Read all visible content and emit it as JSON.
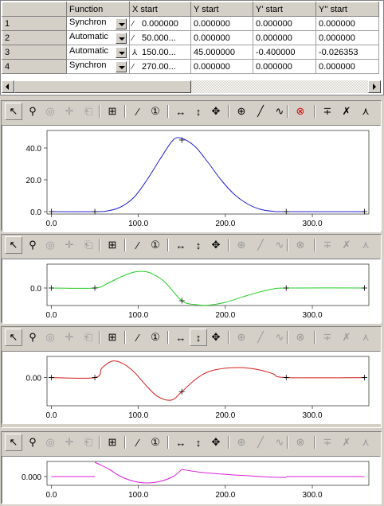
{
  "table": {
    "columns": [
      "",
      "Function",
      "X start",
      "Y start",
      "Y' start",
      "Y'' start"
    ],
    "rows": [
      {
        "num": "1",
        "function": "Synchron",
        "x_start": "0.000000",
        "y_start": "0.000000",
        "yp_start": "0.000000",
        "ypp_start": "0.000000"
      },
      {
        "num": "2",
        "function": "Automatic",
        "x_start": "50.000...",
        "y_start": "0.000000",
        "yp_start": "0.000000",
        "ypp_start": "0.000000"
      },
      {
        "num": "3",
        "function": "Automatic",
        "x_start": "150.00...",
        "y_start": "45.000000",
        "yp_start": "-0.400000",
        "ypp_start": "-0.026353"
      },
      {
        "num": "4",
        "function": "Synchron",
        "x_start": "270.00...",
        "y_start": "0.000000",
        "yp_start": "0.000000",
        "ypp_start": "0.000000"
      }
    ]
  },
  "toolbar_icons": [
    "pointer-icon",
    "zoom-icon",
    "zoom-out-icon",
    "pan-icon",
    "copy-icon",
    "grid-icon",
    "tangent-icon",
    "point-number-icon",
    "zoom-x-icon",
    "zoom-y-icon",
    "zoom-xy-icon",
    "add-point-icon",
    "line-icon",
    "curve-icon",
    "delete-icon",
    "split-icon",
    "cut-icon",
    "fork-icon"
  ],
  "plots": [
    {
      "name": "position",
      "color": "#1f1fcf",
      "ytick_labels": [
        "0.0",
        "20.0",
        "40.0"
      ],
      "yticks": [
        0,
        20,
        40
      ],
      "ylim": [
        -1.5,
        51
      ],
      "xtick_labels": [
        "0.0",
        "100.0",
        "200.0",
        "300.0"
      ],
      "xticks": [
        0,
        100,
        200,
        300
      ],
      "xlim": [
        -5,
        365
      ],
      "points": [
        [
          0,
          0
        ],
        [
          50,
          0
        ],
        [
          65,
          0.5
        ],
        [
          80,
          3
        ],
        [
          95,
          9
        ],
        [
          110,
          20
        ],
        [
          125,
          33
        ],
        [
          140,
          45
        ],
        [
          150,
          46
        ],
        [
          165,
          41
        ],
        [
          180,
          31
        ],
        [
          195,
          20
        ],
        [
          210,
          11
        ],
        [
          225,
          5
        ],
        [
          240,
          1.5
        ],
        [
          255,
          0.2
        ],
        [
          270,
          0
        ],
        [
          360,
          0
        ]
      ],
      "markers": [
        [
          0,
          0
        ],
        [
          50,
          0
        ],
        [
          150,
          45
        ],
        [
          270,
          0
        ],
        [
          360,
          0
        ]
      ]
    },
    {
      "name": "velocity",
      "color": "#22cc22",
      "ytick_labels": [
        "0.0"
      ],
      "yticks": [
        0
      ],
      "ylim": [
        -0.55,
        0.75
      ],
      "xtick_labels": [
        "0.0",
        "100.0",
        "200.0",
        "300.0"
      ],
      "xticks": [
        0,
        100,
        200,
        300
      ],
      "xlim": [
        -5,
        365
      ],
      "points": [
        [
          0,
          0
        ],
        [
          50,
          0
        ],
        [
          65,
          0.15
        ],
        [
          80,
          0.35
        ],
        [
          95,
          0.5
        ],
        [
          105,
          0.52
        ],
        [
          115,
          0.46
        ],
        [
          130,
          0.2
        ],
        [
          150,
          -0.4
        ],
        [
          165,
          -0.52
        ],
        [
          180,
          -0.54
        ],
        [
          200,
          -0.45
        ],
        [
          220,
          -0.28
        ],
        [
          240,
          -0.12
        ],
        [
          255,
          -0.03
        ],
        [
          270,
          0
        ],
        [
          360,
          0
        ]
      ],
      "markers": [
        [
          0,
          0
        ],
        [
          50,
          0
        ],
        [
          150,
          -0.4
        ],
        [
          270,
          0
        ],
        [
          360,
          0
        ]
      ]
    },
    {
      "name": "acceleration",
      "color": "#d41c1c",
      "ytick_labels": [
        "0.00"
      ],
      "yticks": [
        0
      ],
      "ylim": [
        -0.06,
        0.045
      ],
      "xtick_labels": [
        "0.0",
        "100.0",
        "200.0",
        "300.0"
      ],
      "xticks": [
        0,
        100,
        200,
        300
      ],
      "xlim": [
        -5,
        365
      ],
      "points": [
        [
          0,
          0
        ],
        [
          50,
          0
        ],
        [
          58,
          0.02
        ],
        [
          70,
          0.035
        ],
        [
          82,
          0.03
        ],
        [
          95,
          0.012
        ],
        [
          108,
          -0.015
        ],
        [
          122,
          -0.04
        ],
        [
          138,
          -0.048
        ],
        [
          150,
          -0.03
        ],
        [
          165,
          -0.005
        ],
        [
          180,
          0.012
        ],
        [
          200,
          0.02
        ],
        [
          220,
          0.021
        ],
        [
          240,
          0.016
        ],
        [
          255,
          0.008
        ],
        [
          270,
          0
        ],
        [
          360,
          0
        ]
      ],
      "markers": [
        [
          0,
          0
        ],
        [
          50,
          0
        ],
        [
          150,
          -0.03
        ],
        [
          270,
          0
        ],
        [
          360,
          0
        ]
      ]
    },
    {
      "name": "jerk",
      "color": "#d81ed8",
      "ytick_labels": [
        "0.000"
      ],
      "yticks": [
        0
      ],
      "ylim": [
        -0.0055,
        0.0095
      ],
      "xtick_labels": [
        "0.0",
        "100.0",
        "200.0",
        "300.0"
      ],
      "xticks": [
        0,
        100,
        200,
        300
      ],
      "xlim": [
        -5,
        365
      ],
      "segments": [
        [
          [
            0,
            0
          ],
          [
            50,
            0
          ]
        ],
        [
          [
            50,
            0.009
          ],
          [
            65,
            0.005
          ],
          [
            80,
            0.0
          ],
          [
            95,
            -0.003
          ],
          [
            110,
            -0.004
          ],
          [
            125,
            -0.003
          ],
          [
            140,
            0.0
          ],
          [
            150,
            0.0045
          ]
        ],
        [
          [
            150,
            0.0045
          ],
          [
            170,
            0.0028
          ],
          [
            190,
            0.0018
          ],
          [
            210,
            0.001
          ],
          [
            230,
            0.0004
          ],
          [
            250,
            -0.0003
          ],
          [
            270,
            -0.0006
          ]
        ],
        [
          [
            270,
            0
          ],
          [
            360,
            0
          ]
        ]
      ],
      "markers": []
    }
  ]
}
